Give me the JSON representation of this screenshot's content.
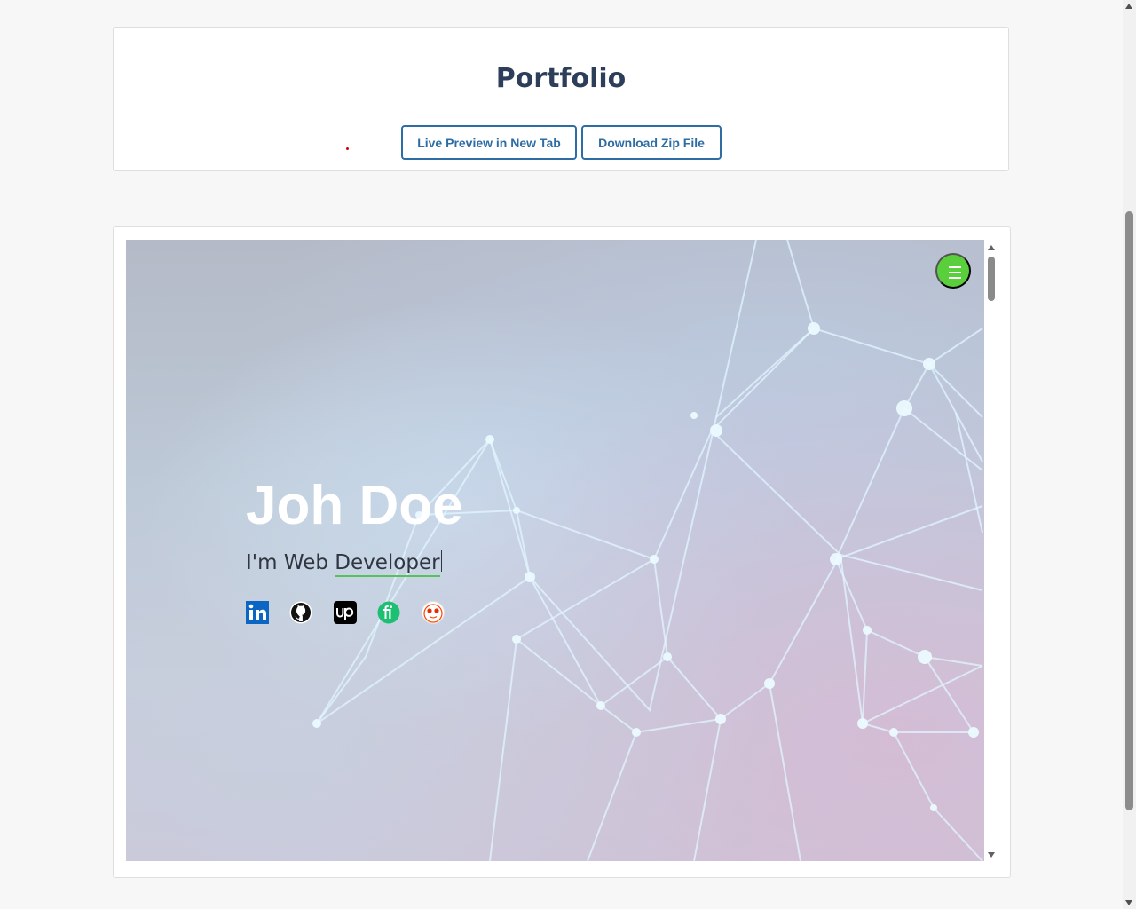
{
  "header": {
    "title": "Portfolio",
    "preview_button_label": "Live Preview in New Tab",
    "download_button_label": "Download Zip File",
    "accent_color": "#2e6da4",
    "title_color": "#2c3e5a"
  },
  "preview": {
    "name": "Joh Doe",
    "role_prefix": "I'm Web ",
    "role_typed": "Developer",
    "menu_icon": "hamburger-menu-icon",
    "menu_color": "#59cf3c",
    "typed_underline_color": "#58c25a",
    "socials": [
      {
        "icon": "linkedin-icon",
        "color": "#0a66c2"
      },
      {
        "icon": "github-icon",
        "color": "#111111"
      },
      {
        "icon": "upwork-icon",
        "color": "#000000"
      },
      {
        "icon": "fiverr-icon",
        "color": "#1dbf73"
      },
      {
        "icon": "reddit-icon",
        "color": "#ff4500"
      }
    ]
  }
}
